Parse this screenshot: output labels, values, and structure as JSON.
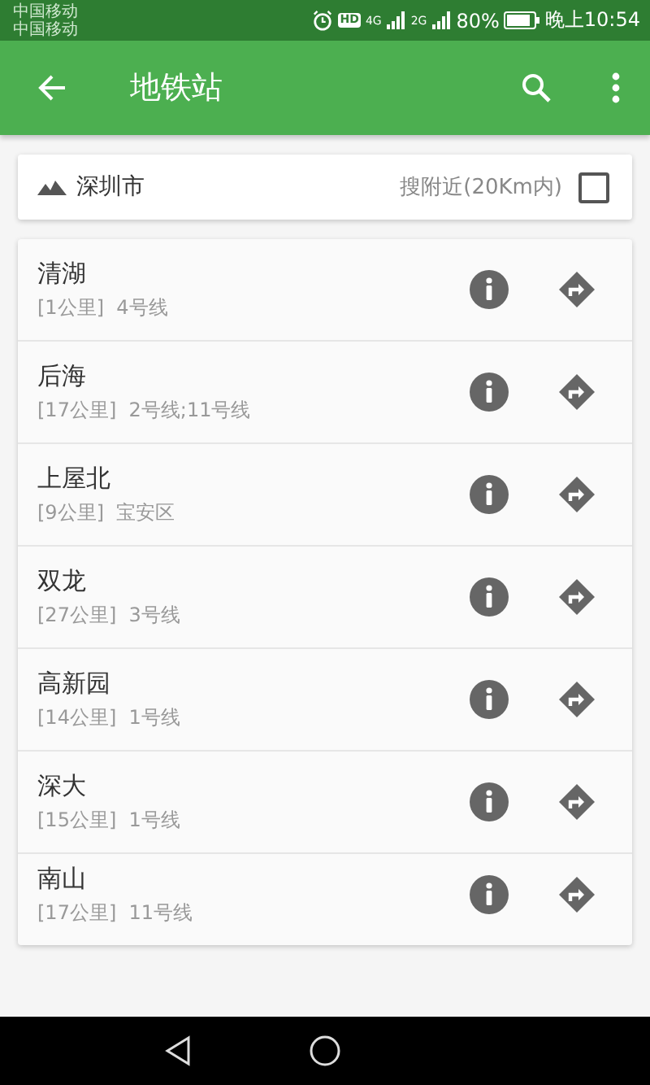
{
  "status_bar": {
    "carriers": [
      "中国移动",
      "中国移动"
    ],
    "hd": "HD",
    "network_1": "4G",
    "network_2": "2G",
    "battery": "80%",
    "time": "晚上10:54"
  },
  "app_bar": {
    "title": "地铁站"
  },
  "filter": {
    "city": "深圳市",
    "nearby_label": "搜附近(20Km内)",
    "nearby_checked": false
  },
  "stations": [
    {
      "name": "清湖",
      "distance": "[1公里]",
      "lines": "4号线"
    },
    {
      "name": "后海",
      "distance": "[17公里]",
      "lines": "2号线;11号线"
    },
    {
      "name": "上屋北",
      "distance": "[9公里]",
      "lines": "宝安区"
    },
    {
      "name": "双龙",
      "distance": "[27公里]",
      "lines": "3号线"
    },
    {
      "name": "高新园",
      "distance": "[14公里]",
      "lines": "1号线"
    },
    {
      "name": "深大",
      "distance": "[15公里]",
      "lines": "1号线"
    },
    {
      "name": "南山",
      "distance": "[17公里]",
      "lines": "11号线"
    }
  ]
}
